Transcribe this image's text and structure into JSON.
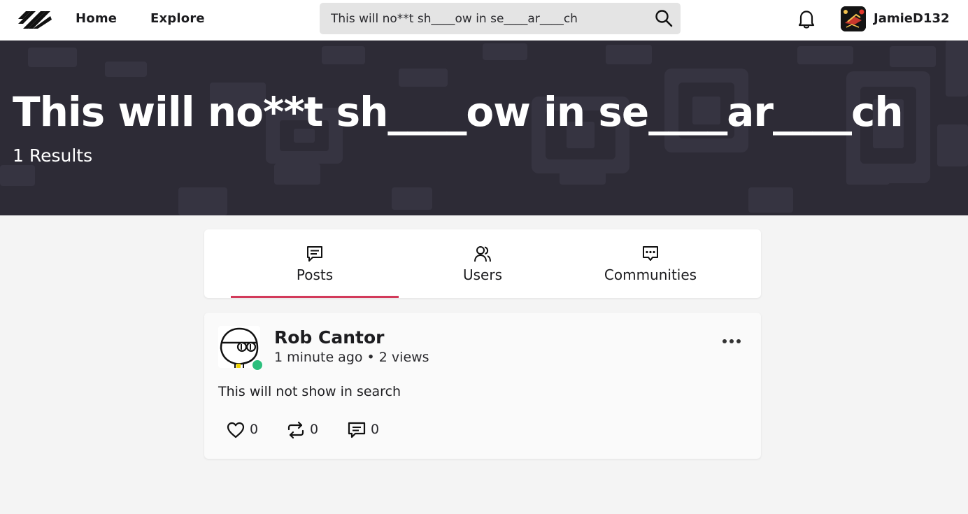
{
  "nav": {
    "home_label": "Home",
    "explore_label": "Explore",
    "search_value": "This will no**t sh____ow in se____ar____ch",
    "username": "JamieD132",
    "icons": [
      "logo-icon",
      "search-icon",
      "bell-icon",
      "user-avatar"
    ]
  },
  "hero": {
    "title": "This will no**t sh____ow in se____ar____ch",
    "count": "1 Results",
    "background": "#2d2b36"
  },
  "tabs": [
    {
      "label": "Posts",
      "icon": "posts-icon",
      "active": true
    },
    {
      "label": "Users",
      "icon": "users-icon",
      "active": false
    },
    {
      "label": "Communities",
      "icon": "communities-icon",
      "active": false
    }
  ],
  "post": {
    "author": "Rob Cantor",
    "meta": "1 minute ago • 2 views",
    "body": "This will not show in search",
    "likes": "0",
    "reposts": "0",
    "comments": "0",
    "online": true
  },
  "colors": {
    "accent": "#d23a5a",
    "online": "#2cbf7d",
    "page_bg": "#f4f4f4"
  }
}
